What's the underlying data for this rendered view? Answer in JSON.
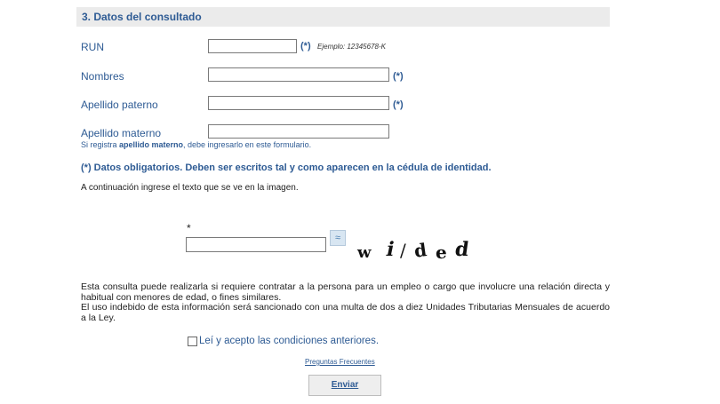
{
  "section": {
    "title": "3. Datos del consultado"
  },
  "form": {
    "run_label": "RUN",
    "run_value": "",
    "run_required": "(*)",
    "run_example": "Ejemplo: 12345678-K",
    "nombres_label": "Nombres",
    "nombres_value": "",
    "nombres_required": "(*)",
    "paterno_label": "Apellido paterno",
    "paterno_value": "",
    "paterno_required": "(*)",
    "materno_label": "Apellido materno",
    "materno_value": "",
    "materno_note_prefix": "Si registra ",
    "materno_note_bold": "apellido materno",
    "materno_note_suffix": ", debe ingresarlo en este formulario.",
    "mandatory_note": "(*) Datos obligatorios. Deben ser escritos tal y como aparecen en la cédula de identidad."
  },
  "captcha": {
    "instruction": "A continuación ingrese el texto que se ve en la imagen.",
    "required_mark": "*",
    "input_value": "",
    "refresh_icon": "refresh-icon",
    "image_text": [
      "w",
      "i",
      "/",
      "d",
      "e",
      "d"
    ]
  },
  "terms": {
    "paragraph1": "Esta consulta puede realizarla si requiere contratar a la persona para un empleo o cargo que involucre una relación directa y habitual con menores de edad, o fines similares.",
    "paragraph2": "El uso indebido de esta información será sancionado con una multa de dos a diez Unidades Tributarias Mensuales de acuerdo a la Ley.",
    "accept_label": "Leí y acepto las condiciones anteriores.",
    "accept_checked": false
  },
  "footer": {
    "faq_link": "Preguntas Frecuentes",
    "submit_label": "Enviar"
  }
}
